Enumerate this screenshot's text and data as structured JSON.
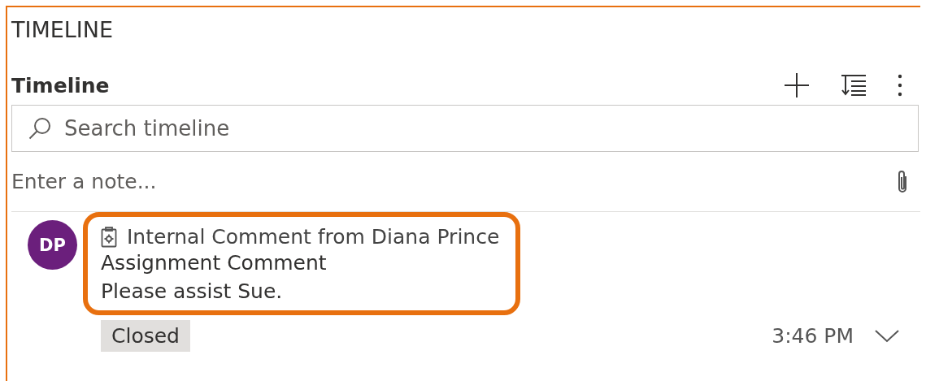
{
  "section_label": "TIMELINE",
  "header": {
    "title": "Timeline"
  },
  "search": {
    "placeholder": "Search timeline"
  },
  "note": {
    "placeholder": "Enter a note..."
  },
  "entries": [
    {
      "avatar_initials": "DP",
      "title": "Internal Comment from Diana Prince",
      "subject": "Assignment Comment",
      "body": "Please assist Sue.",
      "status": "Closed",
      "time": "3:46 PM",
      "highlighted": true
    }
  ]
}
